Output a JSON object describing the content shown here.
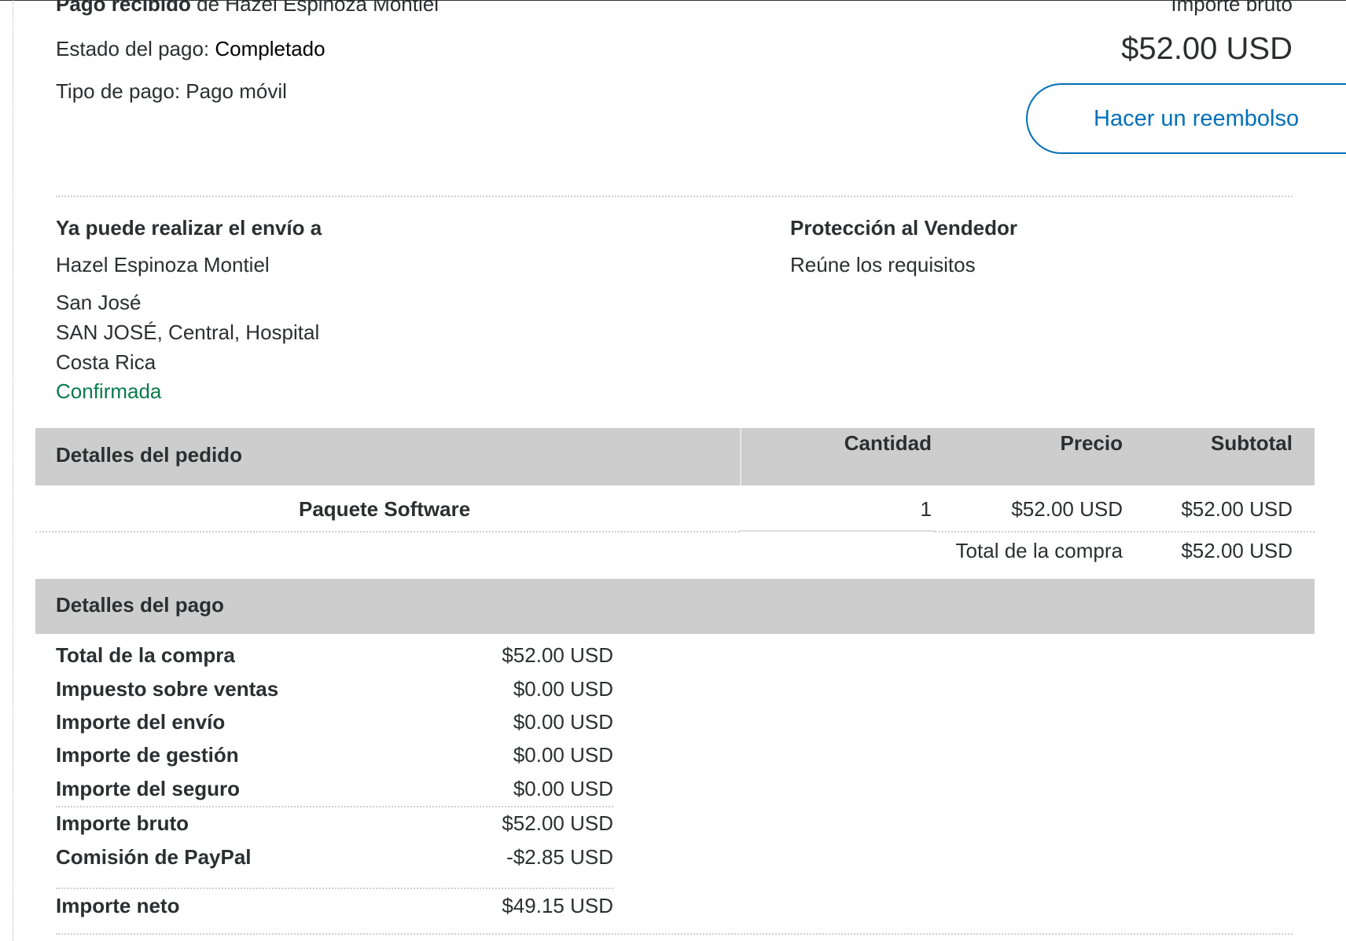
{
  "header": {
    "payment_received_bold": "Pago recibido",
    "payment_received_rest": " de Hazel Espinoza Montiel",
    "status_label": "Estado del pago: ",
    "status_value": "Completado",
    "type_text": "Tipo de pago: Pago móvil",
    "gross_label": "Importe bruto",
    "gross_amount": "$52.00 USD",
    "refund_button": "Hacer un reembolso"
  },
  "shipping": {
    "title": "Ya puede realizar el envío a",
    "name": "Hazel Espinoza Montiel",
    "line1": "San José",
    "line2": "SAN JOSÉ, Central, Hospital",
    "line3": "Costa Rica",
    "status": "Confirmada"
  },
  "protection": {
    "title": "Protección al Vendedor",
    "value": "Reúne los requisitos"
  },
  "order": {
    "title": "Detalles del pedido",
    "columns": {
      "quantity": "Cantidad",
      "price": "Precio",
      "subtotal": "Subtotal"
    },
    "items": [
      {
        "name": "Paquete Software",
        "quantity": "1",
        "price": "$52.00 USD",
        "subtotal": "$52.00 USD"
      }
    ],
    "total_label": "Total de la compra",
    "total_value": "$52.00 USD"
  },
  "payment": {
    "title": "Detalles del pago",
    "rows": [
      {
        "label": "Total de la compra",
        "value": "$52.00 USD"
      },
      {
        "label": "Impuesto sobre ventas",
        "value": "$0.00 USD"
      },
      {
        "label": "Importe del envío",
        "value": "$0.00 USD"
      },
      {
        "label": "Importe de gestión",
        "value": "$0.00 USD"
      },
      {
        "label": "Importe del seguro",
        "value": "$0.00 USD"
      },
      {
        "label": "Importe bruto",
        "value": "$52.00 USD"
      },
      {
        "label": "Comisión de PayPal",
        "value": "-$2.85 USD"
      },
      {
        "label": "Importe neto",
        "value": "$49.15 USD"
      }
    ]
  },
  "colors": {
    "accent": "#0070ba",
    "confirmed": "#0b7a4b",
    "band": "#cdcdcd"
  }
}
